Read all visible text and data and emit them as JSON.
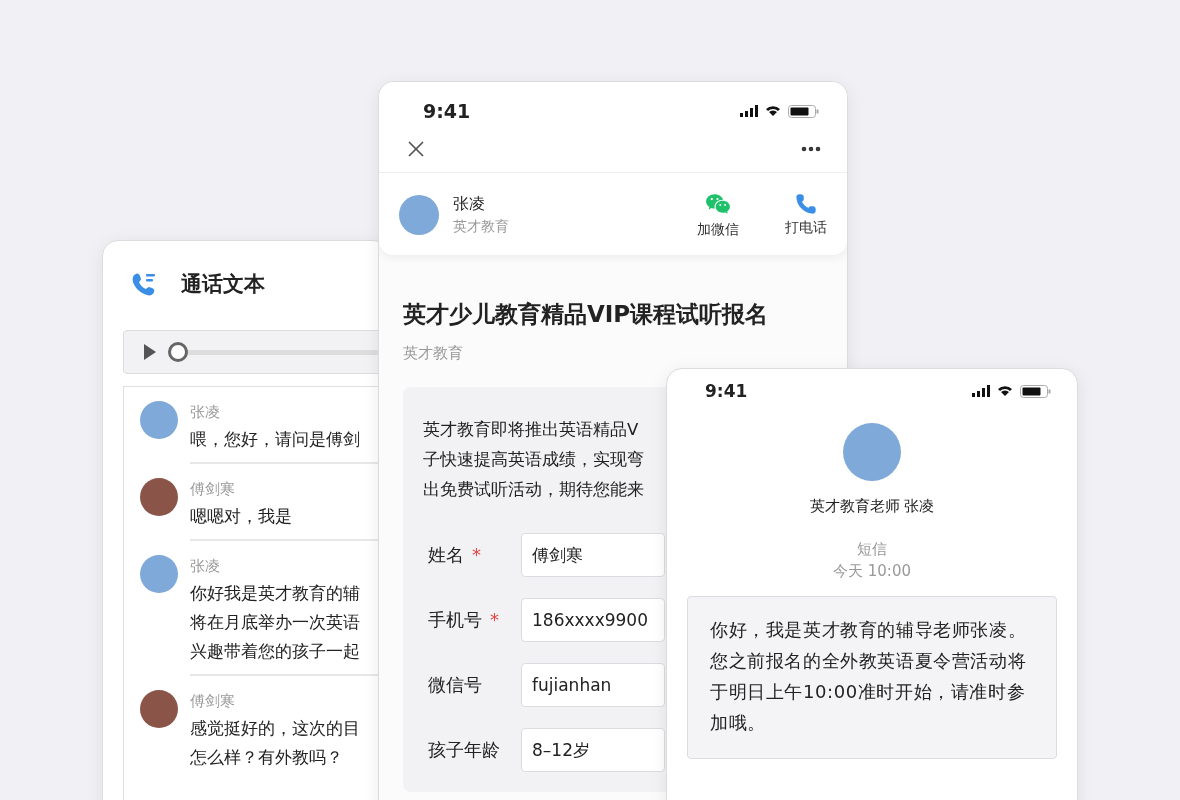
{
  "transcript_card": {
    "title": "通话文本",
    "player": {
      "level": 0
    },
    "messages": [
      {
        "speaker": "张凌",
        "color": "#7fa9d8",
        "lines": [
          "喂，您好，请问是傅剑"
        ]
      },
      {
        "speaker": "傅剑寒",
        "color": "#8a5548",
        "lines": [
          "嗯嗯对，我是"
        ]
      },
      {
        "speaker": "张凌",
        "color": "#7fa9d8",
        "lines": [
          "你好我是英才教育的辅",
          "将在月底举办一次英语",
          "兴趣带着您的孩子一起"
        ]
      },
      {
        "speaker": "傅剑寒",
        "color": "#8a5548",
        "lines": [
          "感觉挺好的，这次的目",
          "怎么样？有外教吗？"
        ]
      }
    ]
  },
  "form_phone": {
    "status_time": "9:41",
    "contact": {
      "name": "张凌",
      "org": "英才教育"
    },
    "actions": [
      {
        "kind": "wechat",
        "label": "加微信"
      },
      {
        "kind": "call",
        "label": "打电话"
      }
    ],
    "title": "英才少儿教育精品VIP课程试听报名",
    "publisher": "英才教育",
    "intro_lines": [
      "英才教育即将推出英语精品V",
      "子快速提高英语成绩，实现弯",
      "出免费试听活动，期待您能来"
    ],
    "fields": [
      {
        "label": "姓名",
        "marker": "*",
        "value": "傅剑寒"
      },
      {
        "label": "手机号",
        "marker": "*",
        "value": "186xxxx9900"
      },
      {
        "label": "微信号",
        "value": "fujianhan"
      },
      {
        "label": "孩子年龄",
        "value": "8–12岁"
      }
    ]
  },
  "sms_phone": {
    "status_time": "9:41",
    "sender": "英才教育老师 张凌",
    "channel": "短信",
    "time": "今天 10:00",
    "message": "你好，我是英才教育的辅导老师张凌。您之前报名的全外教英语夏令营活动将于明日上午10:00准时开始，请准时参加哦。"
  }
}
